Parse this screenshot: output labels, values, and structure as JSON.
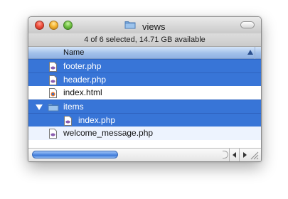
{
  "window": {
    "title": "views"
  },
  "status": {
    "text": "4 of 6 selected, 14.71 GB available"
  },
  "header": {
    "name_column": "Name"
  },
  "files": [
    {
      "name": "footer.php",
      "icon": "php-file-icon",
      "selected": true
    },
    {
      "name": "header.php",
      "icon": "php-file-icon",
      "selected": true
    },
    {
      "name": "index.html",
      "icon": "html-file-icon",
      "selected": false
    },
    {
      "name": "items",
      "icon": "folder-icon",
      "selected": true,
      "expanded": true
    },
    {
      "name": "index.php",
      "icon": "php-file-icon",
      "selected": true,
      "indent": 1
    },
    {
      "name": "welcome_message.php",
      "icon": "php-file-icon",
      "selected": false
    }
  ],
  "colors": {
    "selection": "#3875d7",
    "alt_row": "#edf3fe"
  },
  "scroll": {
    "horizontal_position": 0
  }
}
